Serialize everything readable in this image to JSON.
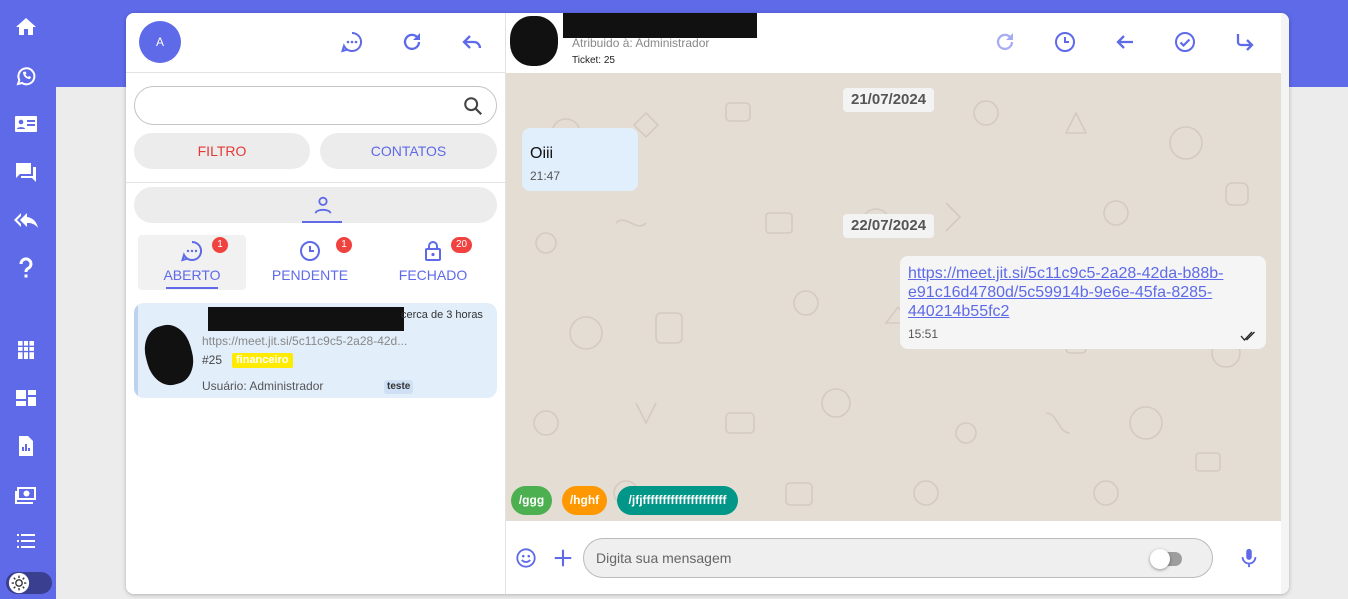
{
  "sidebar": {
    "items": [
      {
        "icon": "home-icon"
      },
      {
        "icon": "whatsapp-icon"
      },
      {
        "icon": "contact-card-icon"
      },
      {
        "icon": "quick-replies-icon"
      },
      {
        "icon": "reply-all-icon"
      },
      {
        "icon": "help-icon"
      },
      {
        "icon": "grid-icon"
      },
      {
        "icon": "kanban-icon"
      },
      {
        "icon": "report-icon"
      },
      {
        "icon": "money-icon"
      },
      {
        "icon": "list-icon"
      },
      {
        "icon": "theme-toggle-icon"
      }
    ]
  },
  "leftpanel": {
    "avatar_letter": "A",
    "search": {
      "placeholder": ""
    },
    "filter_label": "FILTRO",
    "contacts_label": "CONTATOS",
    "tabs": [
      {
        "label": "ABERTO",
        "count": "1",
        "icon": "chat-bubble-icon"
      },
      {
        "label": "PENDENTE",
        "count": "1",
        "icon": "clock-icon"
      },
      {
        "label": "FECHADO",
        "count": "20",
        "icon": "lock-icon"
      }
    ],
    "ticket": {
      "time": "cerca de 3 horas",
      "last_message": "https://meet.jit.si/5c11c9c5-2a28-42d...",
      "number": "#25",
      "tag": "financeiro",
      "user": "Usuário: Administrador",
      "queue": "teste"
    }
  },
  "chat": {
    "header": {
      "assigned": "Atribuido à: Administrador",
      "ticket": "Ticket: 25"
    },
    "dates": [
      "21/07/2024",
      "22/07/2024"
    ],
    "messages": [
      {
        "text": "Oiii",
        "time": "21:47"
      },
      {
        "link_lines": [
          "https://meet.jit.si/5c11c9c5-2a28-42da-b88b-",
          "e91c16d4780d/5c59914b-9e6e-45fa-8285-",
          "440214b55fc2"
        ],
        "time": "15:51"
      }
    ],
    "quick_replies": [
      {
        "label": "/ggg",
        "color": "#4caf50"
      },
      {
        "label": "/hghf",
        "color": "#ff9800"
      },
      {
        "label": "/jfjfffffffffffffffffffff",
        "color": "#009688"
      }
    ],
    "composer": {
      "placeholder": "Digita sua mensagem"
    }
  },
  "colors": {
    "accent": "#5e6ae8",
    "badge": "#f0423f",
    "tag": "#ffeb00",
    "danger_text": "#e53935"
  }
}
